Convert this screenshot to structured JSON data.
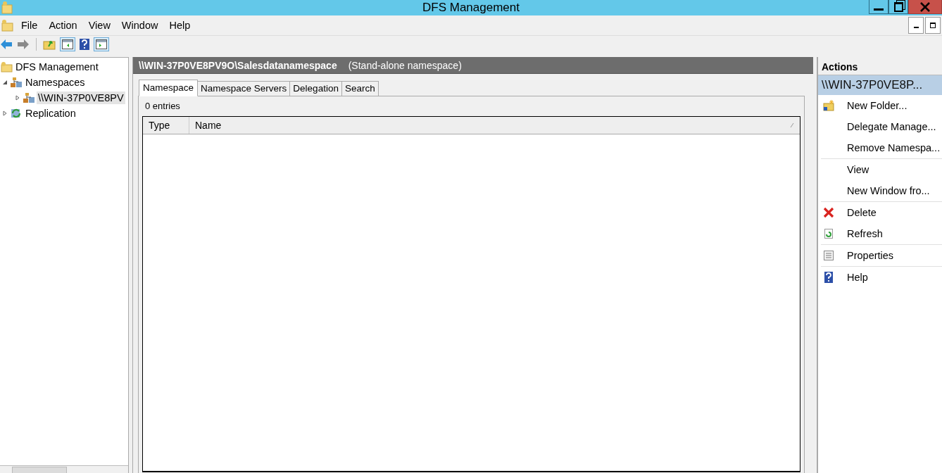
{
  "window": {
    "title": "DFS Management"
  },
  "menu": [
    "File",
    "Action",
    "View",
    "Window",
    "Help"
  ],
  "tree": [
    {
      "label": "DFS Management",
      "kind": "root",
      "selected": false,
      "children": [
        {
          "label": "Namespaces",
          "kind": "namespaces",
          "expanded": true,
          "selected": false,
          "children": [
            {
              "label": "\\\\WIN-37P0VE8PV",
              "kind": "namespace",
              "expanded": false,
              "selected": true
            }
          ]
        },
        {
          "label": "Replication",
          "kind": "replication",
          "expanded": false,
          "selected": false
        }
      ]
    }
  ],
  "header": {
    "path": "\\\\WIN-37P0VE8PV9O\\Salesdatanamespace",
    "type": "(Stand-alone namespace)"
  },
  "tabs": [
    {
      "label": "Namespace",
      "selected": true
    },
    {
      "label": "Namespace Servers",
      "selected": false
    },
    {
      "label": "Delegation",
      "selected": false
    },
    {
      "label": "Search",
      "selected": false
    }
  ],
  "entries": "0 entries",
  "table": {
    "columns": [
      "Type",
      "Name"
    ]
  },
  "actions": {
    "title": "Actions",
    "section": "\\\\WIN-37P0VE8P...",
    "items": [
      {
        "label": "New Folder...",
        "kind": "new-folder",
        "separator_after": false
      },
      {
        "label": "Delegate Manage...",
        "kind": "plain",
        "separator_after": false
      },
      {
        "label": "Remove Namespa...",
        "kind": "plain",
        "separator_after": true
      },
      {
        "label": "View",
        "kind": "plain",
        "separator_after": false
      },
      {
        "label": "New Window fro...",
        "kind": "plain",
        "separator_after": true
      },
      {
        "label": "Delete",
        "kind": "delete",
        "separator_after": false
      },
      {
        "label": "Refresh",
        "kind": "refresh",
        "separator_after": true
      },
      {
        "label": "Properties",
        "kind": "properties",
        "separator_after": true
      },
      {
        "label": "Help",
        "kind": "help",
        "separator_after": false
      }
    ]
  }
}
